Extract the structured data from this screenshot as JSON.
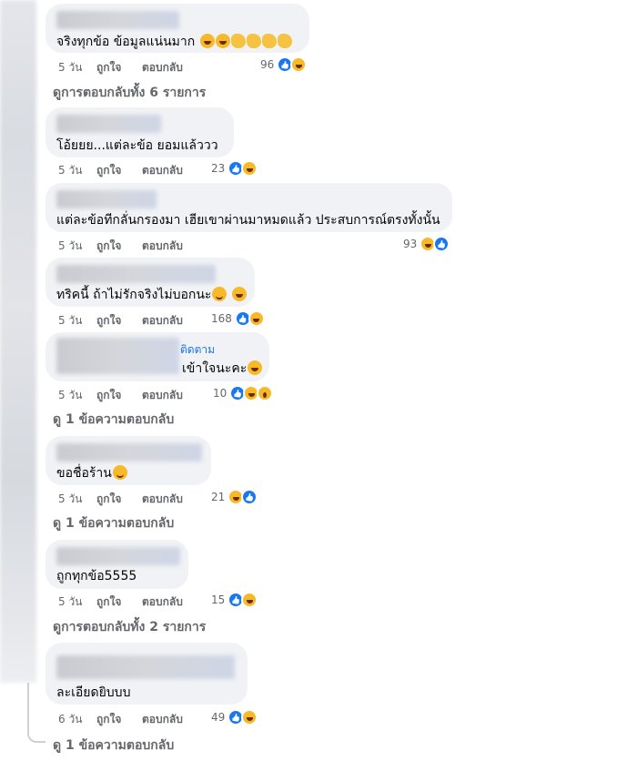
{
  "comments": [
    {
      "text": "จริงทุกข้อ ข้อมูลแน่นมาก",
      "time": "5 วัน",
      "like": "ถูกใจ",
      "reply": "ตอบกลับ",
      "count": "96"
    },
    {
      "text": "โอ้ยยย...แต่ละข้อ ยอมแล้ววว",
      "time": "5 วัน",
      "like": "ถูกใจ",
      "reply": "ตอบกลับ",
      "count": "23"
    },
    {
      "text": "แต่ละข้อทีกลั่นกรองมา เฮียเขาผ่านมาหมดแล้ว ประสบการณ์ตรงทั้งนั้น",
      "time": "5 วัน",
      "like": "ถูกใจ",
      "reply": "ตอบกลับ",
      "count": "93"
    },
    {
      "text": "ทริคนี้ ถ้าไม่รักจริงไม่บอกนะ",
      "time": "5 วัน",
      "like": "ถูกใจ",
      "reply": "ตอบกลับ",
      "count": "168"
    },
    {
      "text": "เข้าใจนะคะ",
      "follow": "ติดตาม",
      "time": "5 วัน",
      "like": "ถูกใจ",
      "reply": "ตอบกลับ",
      "count": "10"
    },
    {
      "text": "ขอชื่อร้าน",
      "time": "5 วัน",
      "like": "ถูกใจ",
      "reply": "ตอบกลับ",
      "count": "21"
    },
    {
      "text": "ถูกทุกข้อ5555",
      "time": "5 วัน",
      "like": "ถูกใจ",
      "reply": "ตอบกลับ",
      "count": "15"
    },
    {
      "text": "ละเอียดยิบบบ",
      "time": "6 วัน",
      "like": "ถูกใจ",
      "reply": "ตอบกลับ",
      "count": "49"
    }
  ],
  "view_replies": [
    "ดูการตอบกลับทั้ง 6 รายการ",
    "ดู 1 ข้อความตอบกลับ",
    "ดู 1 ข้อความตอบกลับ",
    "ดูการตอบกลับทั้ง 2 รายการ",
    "ดู 1 ข้อความตอบกลับ"
  ],
  "colors": {
    "like_blue": "#1877f2",
    "reaction_yellow": "#f7b928",
    "bubble_bg": "#f0f2f5",
    "meta_gray": "#65676b"
  }
}
